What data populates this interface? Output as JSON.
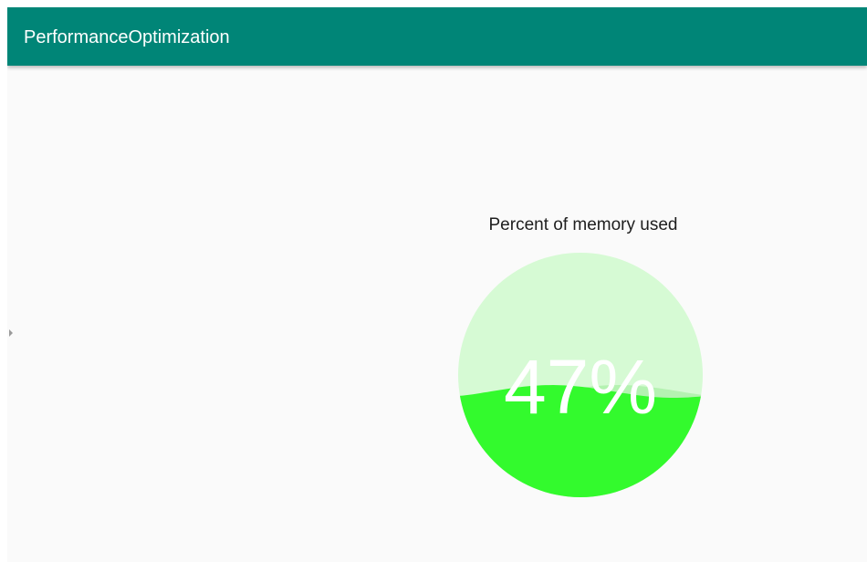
{
  "app_bar": {
    "title": "PerformanceOptimization",
    "color": "#008577"
  },
  "memory_gauge": {
    "label": "Percent of memory used",
    "percent_text": "47%",
    "fill_fraction": 0.47,
    "fill_color": "#33fa2d",
    "back_color": "#d6fad4"
  },
  "icons": {
    "drawer_handle": "caret-right-icon"
  }
}
